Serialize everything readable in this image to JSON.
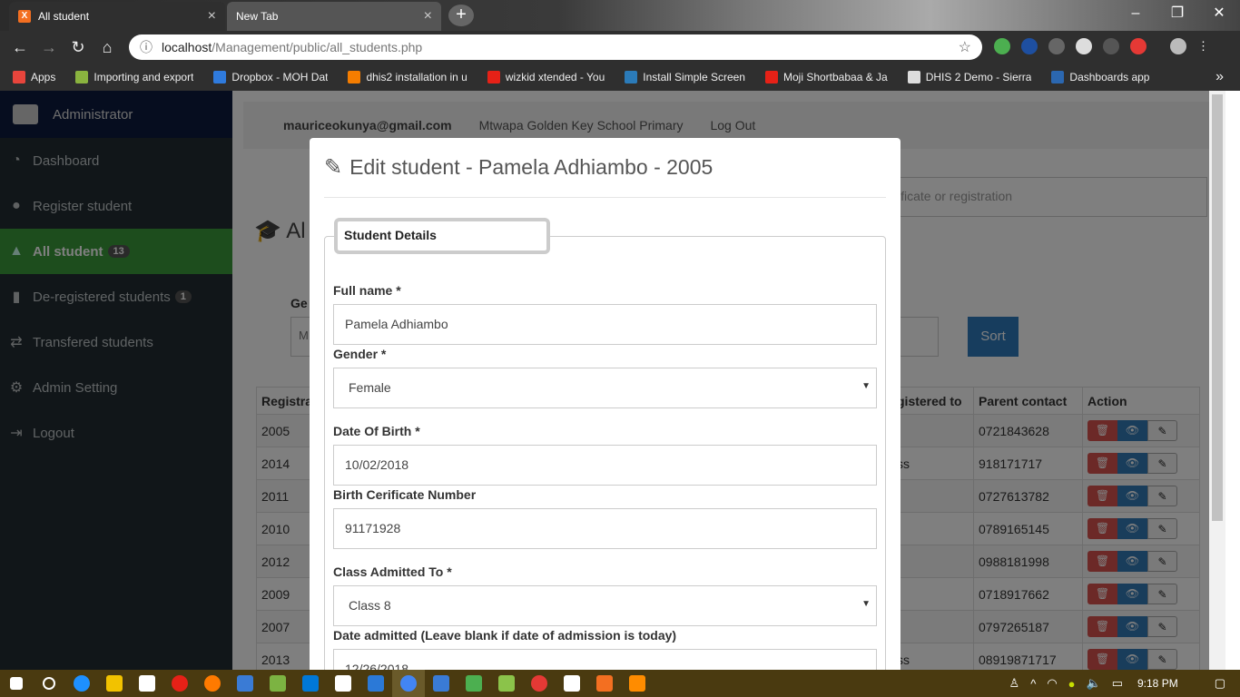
{
  "browser": {
    "tabs": [
      {
        "title": "All student",
        "active": true
      },
      {
        "title": "New Tab",
        "active": false
      }
    ],
    "url_host": "localhost",
    "url_path": "/Management/public/all_students.php",
    "bookmarks": [
      {
        "label": "Apps",
        "color": "#e8453c"
      },
      {
        "label": "Importing and export",
        "color": "#8ab33f"
      },
      {
        "label": "Dropbox - MOH Dat",
        "color": "#2f7bde"
      },
      {
        "label": "dhis2 installation in u",
        "color": "#f57d00"
      },
      {
        "label": "wizkid xtended - You",
        "color": "#e62117"
      },
      {
        "label": "Install Simple Screen",
        "color": "#2b7bb9"
      },
      {
        "label": "Moji Shortbabaa & Ja",
        "color": "#e62117"
      },
      {
        "label": "DHIS 2 Demo - Sierra",
        "color": "#dddddd"
      },
      {
        "label": "Dashboards app",
        "color": "#2b67b0"
      }
    ],
    "more_bookmarks": "»"
  },
  "sidebar": {
    "brand": "Administrator",
    "items": [
      {
        "label": "Dashboard",
        "icon": "dashboard-icon",
        "glyph": "◔",
        "badge": ""
      },
      {
        "label": "Register student",
        "icon": "user-icon",
        "glyph": "●",
        "badge": ""
      },
      {
        "label": "All student",
        "icon": "graduation-cap-icon",
        "glyph": "▲",
        "badge": "13",
        "active": true
      },
      {
        "label": "De-registered students",
        "icon": "trash-icon",
        "glyph": "▮",
        "badge": "1"
      },
      {
        "label": "Transfered students",
        "icon": "exchange-icon",
        "glyph": "⇄",
        "badge": ""
      },
      {
        "label": "Admin Setting",
        "icon": "cogs-icon",
        "glyph": "⚙",
        "badge": ""
      },
      {
        "label": "Logout",
        "icon": "sign-out-icon",
        "glyph": "⇥",
        "badge": ""
      }
    ]
  },
  "topnav": {
    "email": "mauriceokunya@gmail.com",
    "school": "Mtwapa Golden Key School Primary",
    "logout": "Log Out"
  },
  "main": {
    "title": "Al",
    "search_placeholder": "ificate or registration",
    "generate_label": "Ge",
    "generate_select": "M",
    "sort_label": "Sort",
    "table": {
      "columns": [
        "Registra",
        "gistered to",
        "Parent contact",
        "Action"
      ],
      "rows": [
        {
          "reg": "2005",
          "to": "",
          "contact": "0721843628"
        },
        {
          "reg": "2014",
          "to": "ss",
          "contact": "918171717"
        },
        {
          "reg": "2011",
          "to": "",
          "contact": "0727613782"
        },
        {
          "reg": "2010",
          "to": "",
          "contact": "0789165145"
        },
        {
          "reg": "2012",
          "to": "",
          "contact": "0988181998"
        },
        {
          "reg": "2009",
          "to": "",
          "contact": "0718917662"
        },
        {
          "reg": "2007",
          "to": "",
          "contact": "0797265187"
        },
        {
          "reg": "2013",
          "to": "ss",
          "contact": "08919871717"
        }
      ]
    }
  },
  "modal": {
    "title": "Edit student - Pamela Adhiambo - 2005",
    "legend": "Student Details",
    "fields": {
      "full_name_label": "Full name *",
      "full_name_value": "Pamela Adhiambo",
      "gender_label": "Gender *",
      "gender_value": "Female",
      "dob_label": "Date Of Birth *",
      "dob_value": "10/02/2018",
      "birth_cert_label": "Birth Cerificate Number",
      "birth_cert_value": "91171928",
      "class_label": "Class Admitted To *",
      "class_value": "Class 8",
      "date_admitted_label": "Date admitted (Leave blank if date of admission is today)",
      "date_admitted_value": "12/26/2018"
    }
  },
  "taskbar": {
    "clock": "9:18 PM",
    "icons": [
      "#1e90ff",
      "#ffffff",
      "#1e90ff",
      "#f2c200",
      "#ffffff",
      "#e62117",
      "#ff7a00",
      "#3a7bd5",
      "#7cb342",
      "#0078d7",
      "#ffffff",
      "#2b79d7",
      "#4285f4",
      "#3a7bd5",
      "#4caf50",
      "#8bc34a",
      "#e53935",
      "#ffffff",
      "#f36f21",
      "#ff8c00"
    ]
  },
  "colors": {
    "sidebar_active": "#3b9b3b",
    "sort_button": "#2f7bbd",
    "delete_button": "#d9534f",
    "view_button": "#337ab7"
  }
}
